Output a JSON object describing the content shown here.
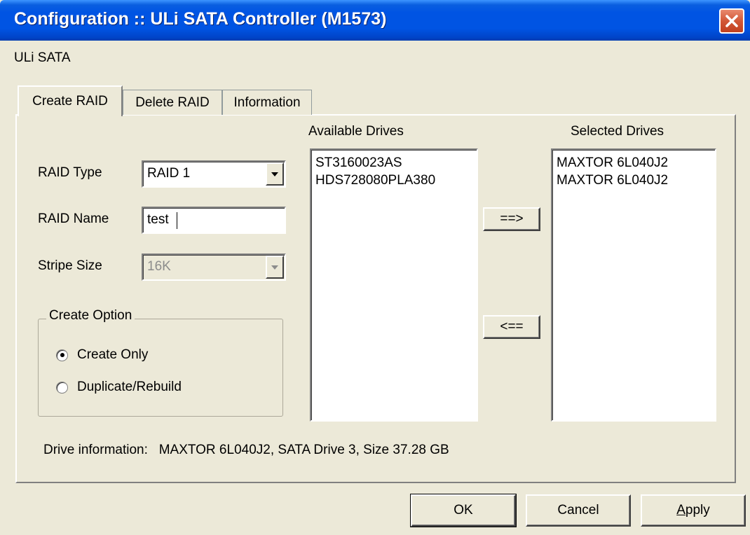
{
  "window": {
    "title": "Configuration :: ULi SATA Controller (M1573)",
    "menu_label": "ULi SATA"
  },
  "tabs": [
    {
      "label": "Create RAID",
      "active": true
    },
    {
      "label": "Delete RAID",
      "active": false
    },
    {
      "label": "Information",
      "active": false
    }
  ],
  "form": {
    "raid_type_label": "RAID Type",
    "raid_type_value": "RAID 1",
    "raid_name_label": "RAID Name",
    "raid_name_value": "test",
    "stripe_size_label": "Stripe Size",
    "stripe_size_value": "16K"
  },
  "create_option": {
    "title": "Create Option",
    "options": [
      {
        "label": "Create Only",
        "selected": true
      },
      {
        "label": "Duplicate/Rebuild",
        "selected": false
      }
    ]
  },
  "available_drives": {
    "title": "Available Drives",
    "items": [
      "ST3160023AS",
      "HDS728080PLA380"
    ]
  },
  "selected_drives": {
    "title": "Selected Drives",
    "items": [
      "MAXTOR 6L040J2",
      "MAXTOR 6L040J2"
    ]
  },
  "move_buttons": {
    "add": "==>",
    "remove": "<=="
  },
  "drive_info": "Drive information:   MAXTOR 6L040J2, SATA Drive 3, Size 37.28 GB",
  "buttons": {
    "ok": "OK",
    "cancel": "Cancel",
    "apply_prefix": "",
    "apply_mnemonic": "A",
    "apply_rest": "pply"
  }
}
